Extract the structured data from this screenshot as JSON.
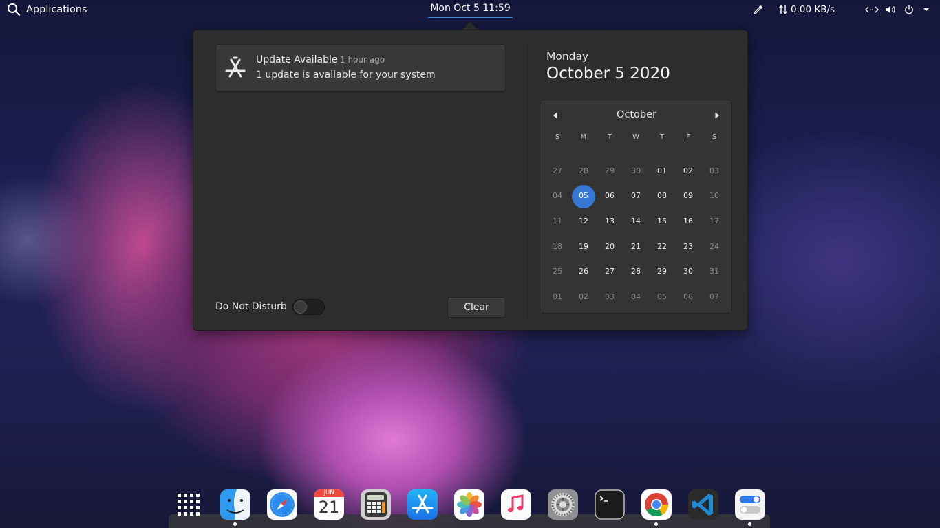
{
  "top_panel": {
    "applications_label": "Applications",
    "clock": "Mon Oct 5  11:59",
    "net_speed": "0.00 KB/s"
  },
  "notifications": [
    {
      "title": "Update Available",
      "time": "1 hour ago",
      "body": "1 update is available for your system",
      "icon": "app-store-icon"
    }
  ],
  "do_not_disturb": {
    "label": "Do Not Disturb",
    "enabled": false
  },
  "clear_label": "Clear",
  "date_header": {
    "day_name": "Monday",
    "full_date": "October 5 2020"
  },
  "calendar": {
    "month": "October",
    "weekdays": [
      "S",
      "M",
      "T",
      "W",
      "T",
      "F",
      "S"
    ],
    "weeks": [
      [
        "27",
        "28",
        "29",
        "30",
        "01",
        "02",
        "03"
      ],
      [
        "04",
        "05",
        "06",
        "07",
        "08",
        "09",
        "10"
      ],
      [
        "11",
        "12",
        "13",
        "14",
        "15",
        "16",
        "17"
      ],
      [
        "18",
        "19",
        "20",
        "21",
        "22",
        "23",
        "24"
      ],
      [
        "25",
        "26",
        "27",
        "28",
        "29",
        "30",
        "31"
      ],
      [
        "01",
        "02",
        "03",
        "04",
        "05",
        "06",
        "07"
      ]
    ],
    "today": "05",
    "accent_color": "#3478d4"
  },
  "dock": {
    "calendar_icon_month": "JUN",
    "calendar_icon_day": "21",
    "items": [
      "app-grid-icon",
      "finder-icon",
      "safari-icon",
      "calendar-icon",
      "calculator-icon",
      "app-store-icon",
      "photos-icon",
      "music-icon",
      "settings-icon",
      "terminal-icon",
      "chrome-icon",
      "vscode-icon",
      "tweaks-icon"
    ],
    "running": [
      "finder-icon",
      "chrome-icon",
      "tweaks-icon"
    ]
  }
}
